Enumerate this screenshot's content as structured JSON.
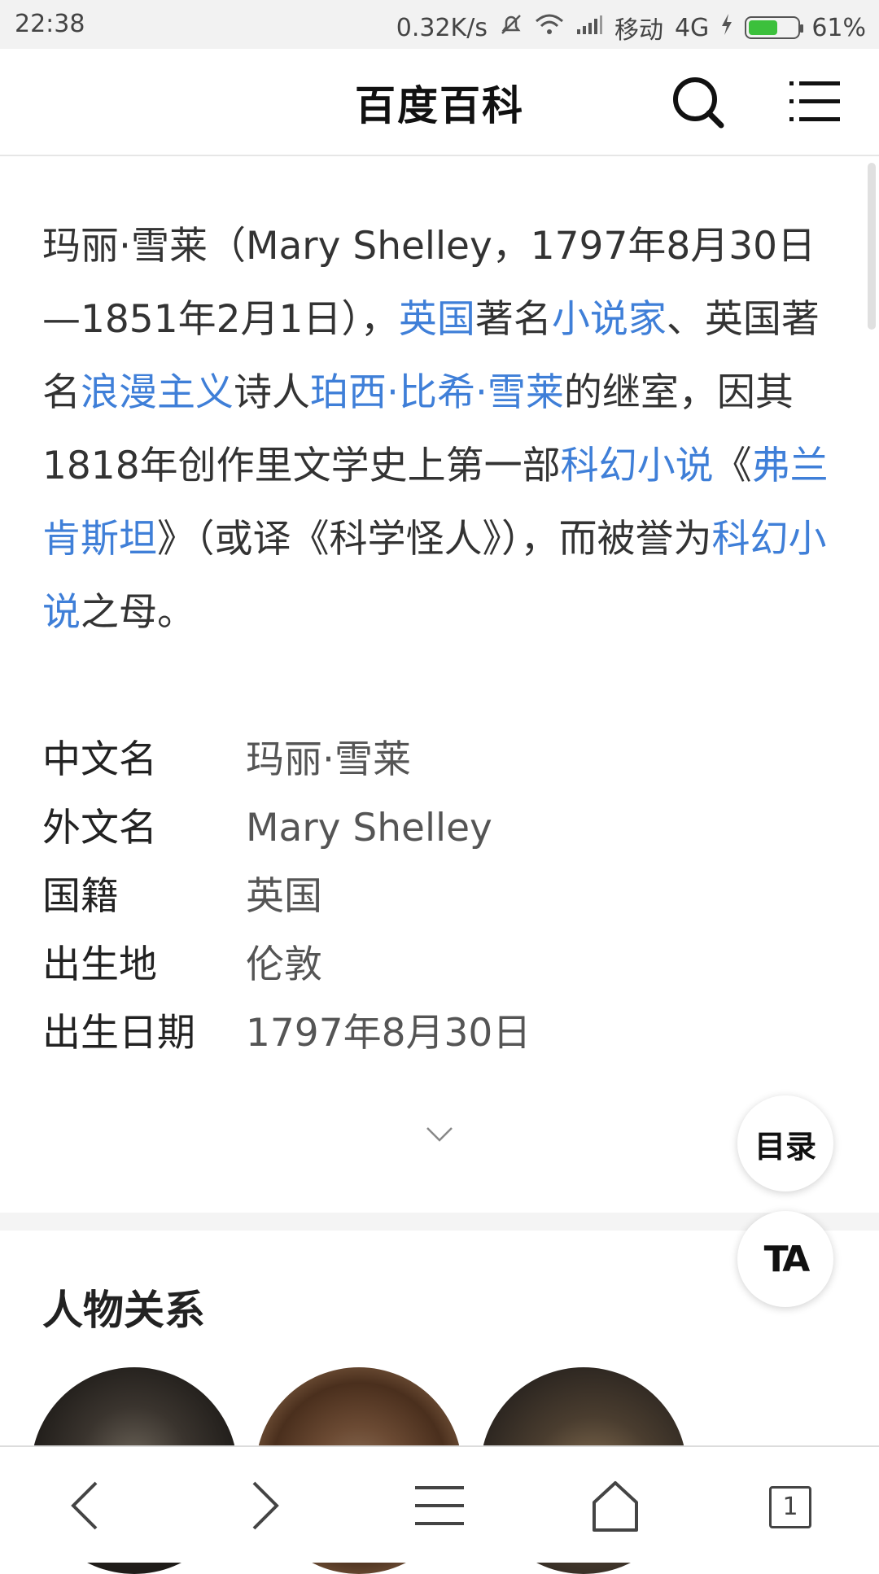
{
  "status_bar": {
    "time": "22:38",
    "net_speed": "0.32K/s",
    "carrier": "移动",
    "network": "4G",
    "battery": "61%",
    "battery_level": 0.61
  },
  "header": {
    "brand": "百度百科",
    "icons": [
      "search-icon",
      "menu-icon"
    ]
  },
  "summary": [
    {
      "t": "玛丽·雪莱（Mary Shelley，1797年8月30日—1851年2月1日），"
    },
    {
      "t": "英国",
      "link": true
    },
    {
      "t": "著名"
    },
    {
      "t": "小说家",
      "link": true
    },
    {
      "t": "、英国著名"
    },
    {
      "t": "浪漫主义",
      "link": true
    },
    {
      "t": "诗人"
    },
    {
      "t": "珀西·比希·雪莱",
      "link": true
    },
    {
      "t": "的继室，因其1818年创作里文学史上第一部"
    },
    {
      "t": "科幻小说",
      "link": true
    },
    {
      "t": "《"
    },
    {
      "t": "弗兰肯斯坦",
      "link": true
    },
    {
      "t": "》（或译《科学怪人》），而被誉为"
    },
    {
      "t": "科幻小说",
      "link": true
    },
    {
      "t": "之母。"
    }
  ],
  "infobox": [
    {
      "key": "中文名",
      "value": "玛丽·雪莱"
    },
    {
      "key": "外文名",
      "value": "Mary Shelley"
    },
    {
      "key": "国籍",
      "value": "英国"
    },
    {
      "key": "出生地",
      "value": "伦敦"
    },
    {
      "key": "出生日期",
      "value": "1797年8月30日"
    }
  ],
  "fab": {
    "toc": "目录",
    "font": "TA"
  },
  "relations": {
    "title": "人物关系"
  },
  "bottom_bar": {
    "tab_count": "1",
    "icons": [
      "back-icon",
      "forward-icon",
      "menu-icon",
      "home-icon",
      "tabs-icon"
    ]
  },
  "colors": {
    "link": "#3f7fd8",
    "battery": "#3cc03c"
  }
}
